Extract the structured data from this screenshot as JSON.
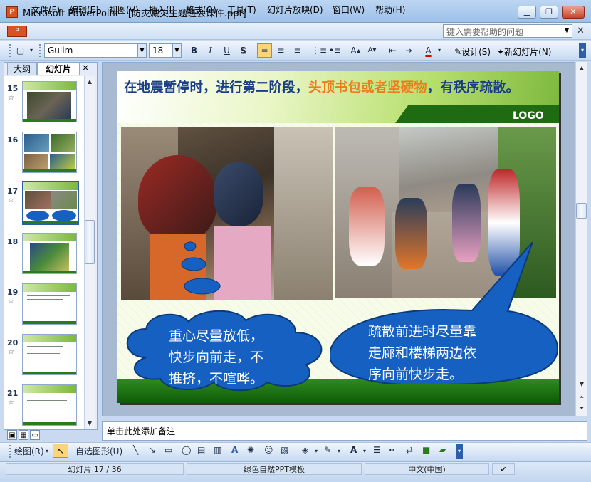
{
  "window": {
    "title": "Microsoft PowerPoint - [防灾减灾主题班会课件.ppt]",
    "app_icon": "powerpoint-icon",
    "controls": [
      "minimize-icon",
      "restore-icon",
      "close-icon"
    ]
  },
  "menu": {
    "items": [
      "文件(F)",
      "编辑(E)",
      "视图(V)",
      "插入(I)",
      "格式(O)",
      "工具(T)",
      "幻灯片放映(D)",
      "窗口(W)",
      "帮助(H)"
    ],
    "help_placeholder": "键入需要帮助的问题"
  },
  "toolbar": {
    "font": "Gulim",
    "size": "18",
    "bold": "B",
    "italic": "I",
    "underline": "U",
    "shadow": "S",
    "design_label": "设计(S)",
    "new_slide_label": "新幻灯片(N)"
  },
  "panel": {
    "tab_outline": "大纲",
    "tab_slides": "幻灯片",
    "close": "×",
    "thumbnails": [
      {
        "number": "15"
      },
      {
        "number": "16"
      },
      {
        "number": "17",
        "selected": true
      },
      {
        "number": "18"
      },
      {
        "number": "19"
      },
      {
        "number": "20"
      },
      {
        "number": "21"
      }
    ]
  },
  "slide": {
    "title_part1": "在地震暂停时，进行第二阶段，",
    "title_highlight": "头顶书包或者坚硬物",
    "title_part2": "，有秩序疏散。",
    "logo": "LOGO",
    "bubble_left": [
      "重心尽量放低，",
      "快步向前走，不",
      "推挤，不喧哗。"
    ],
    "bubble_right": [
      "疏散前进时尽量靠",
      "走廊和楼梯两边依",
      "序向前快步走。"
    ]
  },
  "notes": {
    "placeholder": "单击此处添加备注"
  },
  "drawbar": {
    "draw_label": "绘图(R)",
    "autoshape_label": "自选图形(U)"
  },
  "status": {
    "slide_counter": "幻灯片 17 / 36",
    "template": "绿色自然PPT模板",
    "language": "中文(中国)"
  },
  "colors": {
    "title_blue": "#1a3d86",
    "title_highlight_orange": "#f07b1c",
    "slide_green": "#1e6b12",
    "bubble_blue": "#1560c0"
  }
}
